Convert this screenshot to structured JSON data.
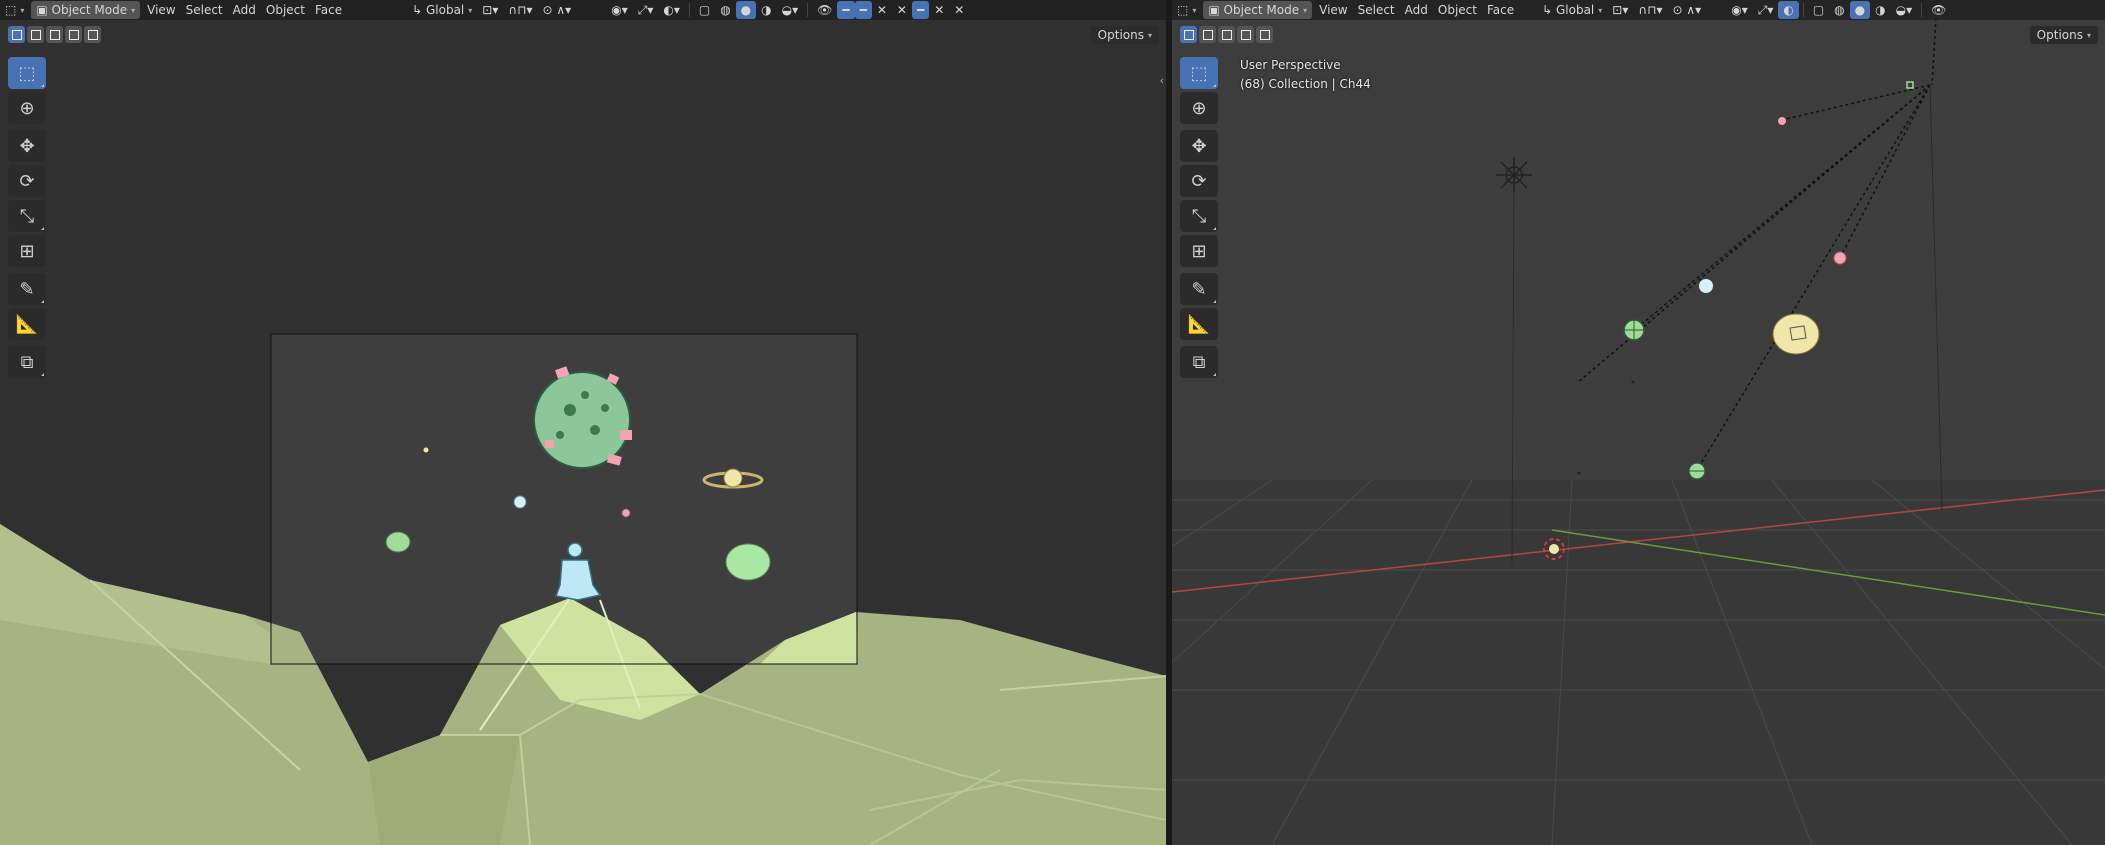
{
  "left_viewport": {
    "header": {
      "editor_icon": "cube-editor-icon",
      "mode": "Object Mode",
      "menus": [
        "View",
        "Select",
        "Add",
        "Object",
        "Face"
      ],
      "orientation": "Global"
    },
    "options_label": "Options"
  },
  "right_viewport": {
    "header": {
      "editor_icon": "cube-editor-icon",
      "mode": "Object Mode",
      "menus": [
        "View",
        "Select",
        "Add",
        "Object",
        "Face"
      ],
      "orientation": "Global"
    },
    "options_label": "Options",
    "overlay": {
      "view_name": "User Perspective",
      "collection_info": "(68) Collection | Ch44"
    }
  },
  "toolbar_tools": [
    "select-box",
    "cursor",
    "move",
    "rotate",
    "scale",
    "transform",
    "annotate",
    "measure",
    "add-cube"
  ],
  "colors": {
    "accent": "#4772b3",
    "terrain": "#a4b07e",
    "terrain_light": "#cfe0a0",
    "planet_green": "#9fdc98",
    "planet_blue": "#d3f0ff",
    "planet_pink": "#f4a3b4",
    "saturn": "#f1e6a8"
  }
}
